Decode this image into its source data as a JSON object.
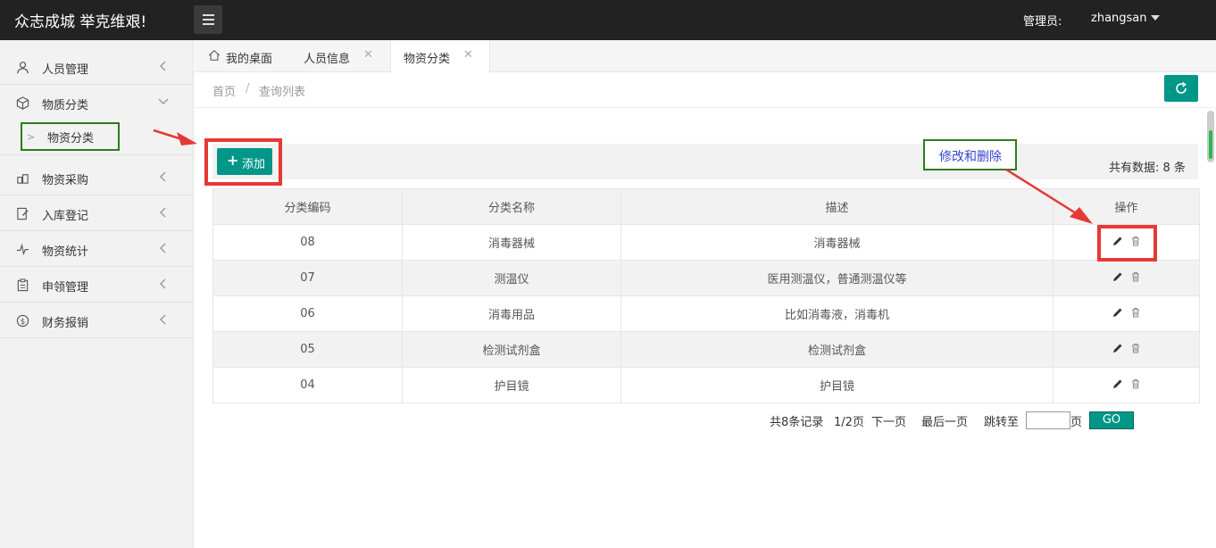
{
  "app": {
    "title": "众志成城 举克维艰!"
  },
  "header": {
    "admin_label": "管理员:",
    "username": "zhangsan"
  },
  "sidebar": {
    "items": [
      {
        "label": "人员管理",
        "icon": "person-icon"
      },
      {
        "label": "物质分类",
        "icon": "box-icon",
        "expanded": true
      },
      {
        "label": "物资采购",
        "icon": "cart-icon"
      },
      {
        "label": "入库登记",
        "icon": "register-icon"
      },
      {
        "label": "物资统计",
        "icon": "chart-pulse-icon"
      },
      {
        "label": "申领管理",
        "icon": "clipboard-icon"
      },
      {
        "label": "财务报销",
        "icon": "dollar-icon"
      }
    ],
    "sub_item": {
      "label": "物资分类"
    }
  },
  "tabs": [
    {
      "label": "我的桌面",
      "icon": "home-icon"
    },
    {
      "label": "人员信息",
      "closable": true
    },
    {
      "label": "物资分类",
      "closable": true,
      "active": true
    }
  ],
  "breadcrumb": {
    "home": "首页",
    "separator": "/",
    "current": "查询列表"
  },
  "toolbar": {
    "add_label": "添加",
    "total_text": "共有数据: 8 条"
  },
  "annotation": {
    "text": "修改和删除"
  },
  "table": {
    "headers": [
      "分类编码",
      "分类名称",
      "描述",
      "操作"
    ],
    "rows": [
      {
        "code": "08",
        "name": "消毒器械",
        "desc": "消毒器械"
      },
      {
        "code": "07",
        "name": "测温仪",
        "desc": "医用测温仪，普通测温仪等"
      },
      {
        "code": "06",
        "name": "消毒用品",
        "desc": "比如消毒液，消毒机"
      },
      {
        "code": "05",
        "name": "检测试剂盒",
        "desc": "检测试剂盒"
      },
      {
        "code": "04",
        "name": "护目镜",
        "desc": "护目镜"
      }
    ]
  },
  "pager": {
    "total_records": "共8条记录",
    "page_info": "1/2页",
    "next": "下一页",
    "last": "最后一页",
    "jump_to": "跳转至",
    "page_suffix": "页",
    "jump_value": "",
    "go_label": "GO"
  },
  "colors": {
    "accent": "#009688",
    "topbar": "#222222",
    "annotation_red": "#e53935",
    "annotation_green": "#2e7d1b"
  }
}
